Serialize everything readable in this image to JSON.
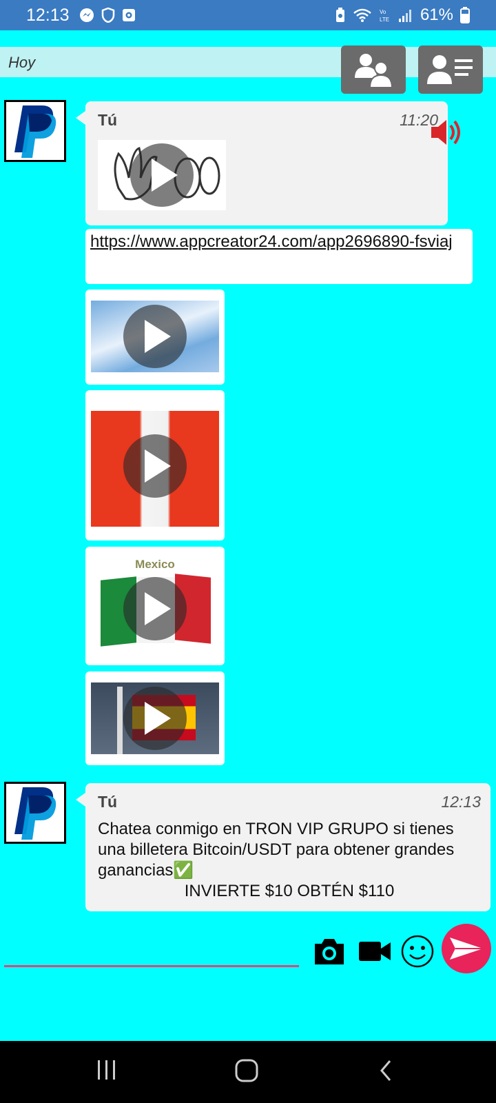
{
  "status_bar": {
    "time": "12:13",
    "battery_percent": "61%",
    "left_icons": [
      "messenger-icon",
      "shield-icon",
      "camera-app-icon"
    ],
    "right_icons": [
      "battery-saver-icon",
      "wifi-icon",
      "lte-icon",
      "signal-icon",
      "battery-icon"
    ]
  },
  "header": {
    "date_label": "Hoy",
    "buttons": [
      "group-users-icon",
      "profile-list-icon"
    ]
  },
  "messages": [
    {
      "sender": "Tú",
      "time": "11:20",
      "has_audio_icon": true,
      "link": "https://www.appcreator24.com/app2696890-fsviaj",
      "videos": [
        "hand-wave-gif",
        "argentina-flag-video",
        "peru-flag-video",
        "mexico-flag-video",
        "spain-flag-video"
      ],
      "mexico_caption": "Mexico"
    },
    {
      "sender": "Tú",
      "time": "12:13",
      "text": "Chatea conmigo en TRON VIP GRUPO si tienes una billetera Bitcoin/USDT para obtener grandes ganancias✅",
      "text_line2": "INVIERTE $10 OBTÉN $110"
    }
  ],
  "composer": {
    "placeholder": "",
    "tools": [
      "camera-icon",
      "video-camera-icon",
      "emoji-icon",
      "send-icon"
    ]
  },
  "colors": {
    "background": "#00ffff",
    "status_bar": "#3a7bc2",
    "send_button": "#e8245a",
    "input_underline": "#e0457a"
  }
}
